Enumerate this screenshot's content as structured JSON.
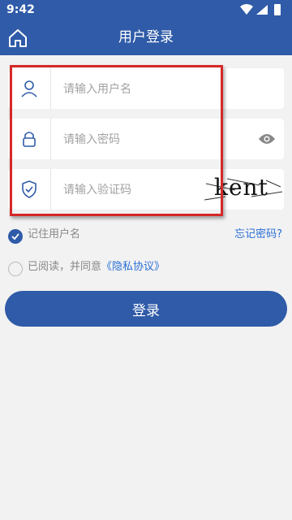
{
  "status_bar": {
    "time": "9:42"
  },
  "app_bar": {
    "title": "用户登录"
  },
  "form": {
    "username_placeholder": "请输入用户名",
    "password_placeholder": "请输入密码",
    "captcha_placeholder": "请输入验证码",
    "captcha_text": "kent"
  },
  "options": {
    "remember_label": "记住用户名",
    "remember_checked": true,
    "forgot_label": "忘记密码?",
    "agree_prefix": "已阅读，并同意",
    "agree_link": "《隐私协议》",
    "agree_checked": false
  },
  "login_button": "登录",
  "colors": {
    "primary": "#2f5ba8",
    "link": "#2a6fd6",
    "highlight": "#d62828"
  }
}
